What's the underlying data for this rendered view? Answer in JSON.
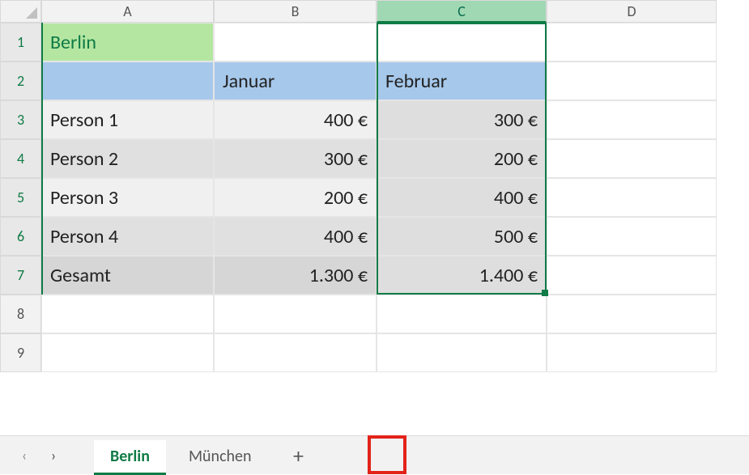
{
  "columns": [
    "A",
    "B",
    "C",
    "D"
  ],
  "rows": [
    "1",
    "2",
    "3",
    "4",
    "5",
    "6",
    "7",
    "8",
    "9"
  ],
  "active_column": "C",
  "sheet": {
    "title_cell": "Berlin",
    "headers": {
      "col_b": "Januar",
      "col_c": "Februar"
    },
    "data": [
      {
        "label": "Person 1",
        "b": "400 €",
        "c": "300 €"
      },
      {
        "label": "Person 2",
        "b": "300 €",
        "c": "200 €"
      },
      {
        "label": "Person 3",
        "b": "200 €",
        "c": "400 €"
      },
      {
        "label": "Person 4",
        "b": "400 €",
        "c": "500 €"
      }
    ],
    "total": {
      "label": "Gesamt",
      "b": "1.300 €",
      "c": "1.400 €"
    }
  },
  "tabs": {
    "active": "Berlin",
    "other": "München",
    "add_label": "+"
  },
  "nav": {
    "prev": "‹",
    "next": "›"
  }
}
